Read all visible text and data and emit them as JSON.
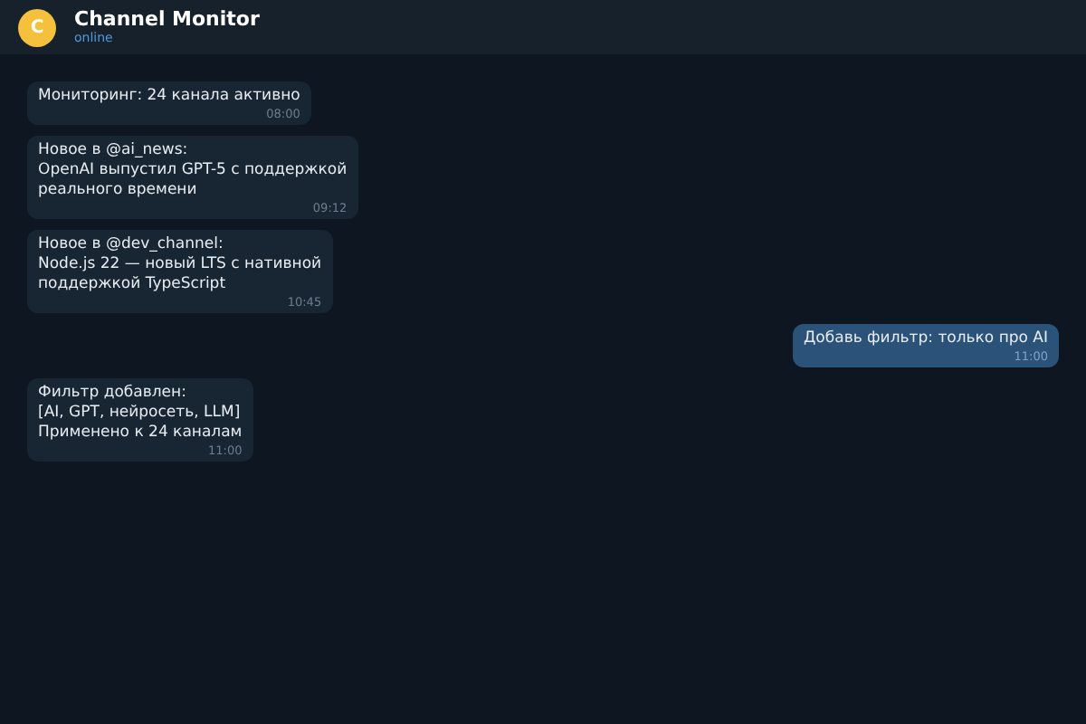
{
  "header": {
    "avatar_letter": "C",
    "title": "Channel Monitor",
    "status": "online"
  },
  "messages": [
    {
      "kind": "incoming",
      "text": "Мониторинг: 24 канала активно",
      "time": "08:00"
    },
    {
      "kind": "incoming",
      "text": "Новое в @ai_news:\nOpenAI выпустил GPT-5 с поддержкой\nреального времени",
      "time": "09:12"
    },
    {
      "kind": "incoming",
      "text": "Новое в @dev_channel:\nNode.js 22 — новый LTS с нативной\nподдержкой TypeScript",
      "time": "10:45"
    },
    {
      "kind": "outgoing",
      "text": "Добавь фильтр: только про AI",
      "time": "11:00"
    },
    {
      "kind": "incoming",
      "text": "Фильтр добавлен:\n[AI, GPT, нейросеть, LLM]\nПрименено к 24 каналам",
      "time": "11:00"
    }
  ]
}
